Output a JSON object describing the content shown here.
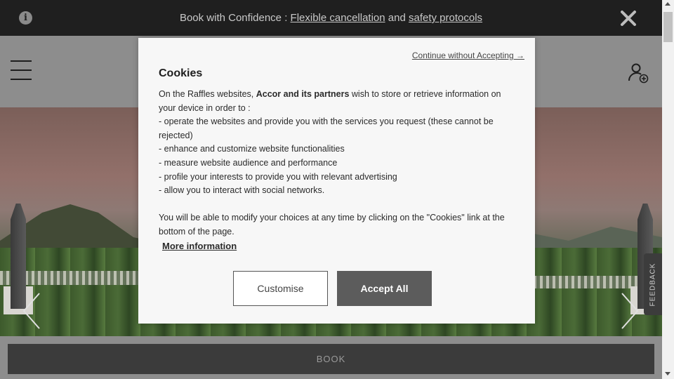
{
  "banner": {
    "prefix": "Book with Confidence : ",
    "link1": "Flexible cancellation",
    "middle": " and ",
    "link2": "safety protocols",
    "info_icon": "info-icon",
    "close_icon": "close-icon"
  },
  "header": {
    "menu_icon": "hamburger-menu-icon",
    "account_icon": "user-add-icon"
  },
  "hero": {
    "prev_icon": "chevron-left-icon",
    "next_icon": "chevron-right-icon"
  },
  "feedback": {
    "label": "FEEDBACK"
  },
  "book": {
    "label": "BOOK"
  },
  "cookie_modal": {
    "continue_label": "Continue without Accepting →",
    "title": "Cookies",
    "intro_before": "On the Raffles websites, ",
    "intro_bold": "Accor and its partners",
    "intro_after": " wish to store or retrieve information on your device in order to :",
    "items": [
      "- operate the websites and provide you with the services you request (these cannot be rejected)",
      "- enhance and customize website functionalities",
      "- measure website audience and performance",
      "- profile your interests to provide you with relevant advertising",
      "- allow you to interact with social networks."
    ],
    "modify_text": "You will be able to modify your choices at any time by clicking on the \"Cookies\" link at the bottom of the page.",
    "more_info": "More information",
    "customise_label": "Customise",
    "accept_label": "Accept All"
  },
  "colors": {
    "banner_bg": "#1f1f1f",
    "header_overlay": "#8d8d8d",
    "modal_bg": "#f7f7f7",
    "accept_bg": "#5c5c5c",
    "book_bg": "#3b3b3b"
  }
}
